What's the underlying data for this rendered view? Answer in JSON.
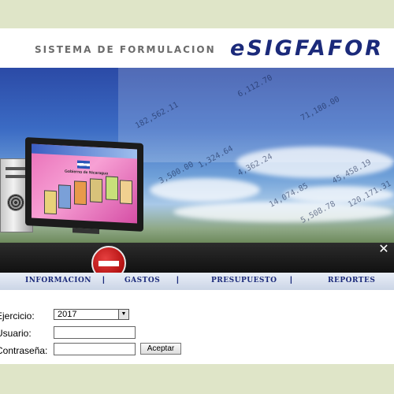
{
  "header": {
    "subtitle": "SISTEMA DE FORMULACION",
    "logo": "eSIGFAFOR"
  },
  "banner": {
    "monitor_screen_text": "Gobierno de Nicaragua",
    "close_symbol": "✕"
  },
  "nav": {
    "items": [
      {
        "label": "INFORMACION"
      },
      {
        "label": "GASTOS"
      },
      {
        "label": "PRESUPUESTO"
      },
      {
        "label": "REPORTES"
      }
    ],
    "separator": "|"
  },
  "form": {
    "ejercicio_label": "Ejercicio:",
    "ejercicio_value": "2017",
    "usuario_label": "Usuario:",
    "usuario_value": "",
    "contrasena_label": "Contraseña:",
    "contrasena_value": "",
    "submit_label": "Aceptar"
  },
  "colors": {
    "brand_navy": "#1b2a7a",
    "page_bg": "#dfe5c8",
    "stop_red": "#c81818"
  },
  "icons": {
    "close": "close-icon",
    "stop": "stop-sign-icon",
    "dropdown": "chevron-down-icon"
  }
}
